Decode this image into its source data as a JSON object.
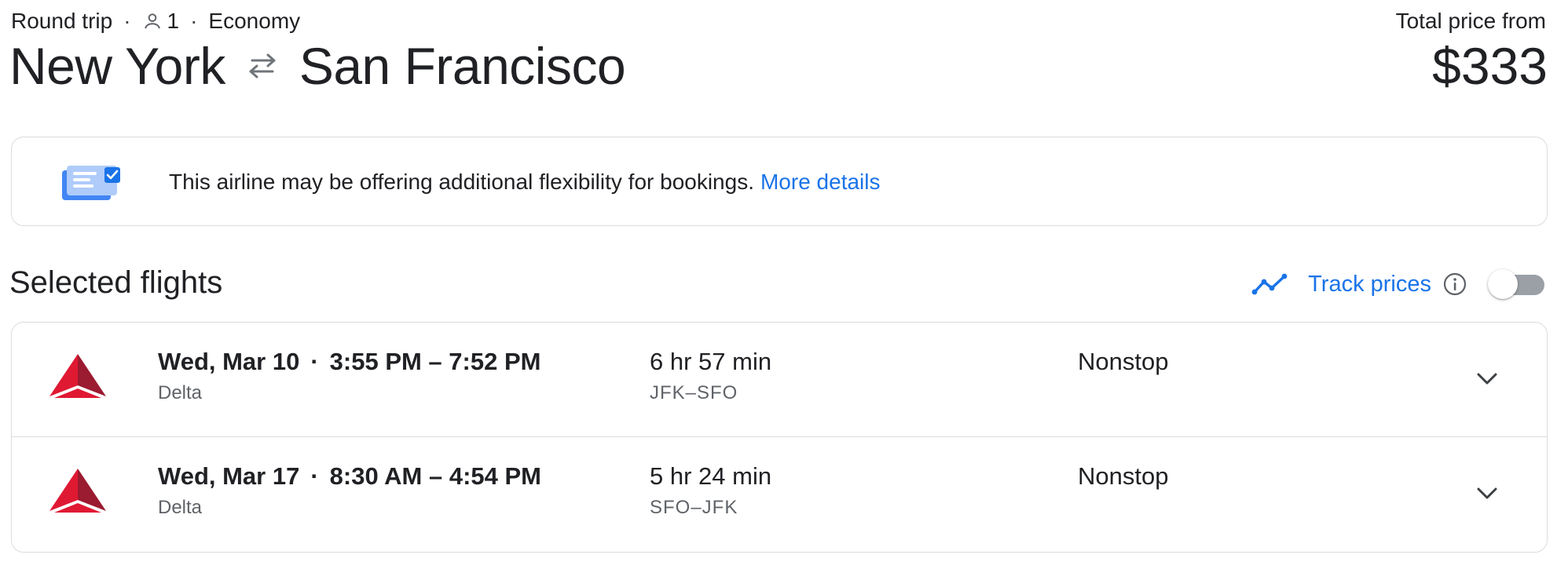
{
  "trip": {
    "type": "Round trip",
    "passengers": "1",
    "cabin": "Economy",
    "separator": "·",
    "origin": "New York",
    "destination": "San Francisco"
  },
  "price": {
    "label": "Total price from",
    "value": "$333"
  },
  "banner": {
    "text": "This airline may be offering additional flexibility for bookings.",
    "link": "More details",
    "icon": "flexible-booking-icon"
  },
  "selected": {
    "title": "Selected flights",
    "track_label": "Track prices",
    "track_enabled": false
  },
  "flights": [
    {
      "date": "Wed, Mar 10",
      "times": "3:55 PM – 7:52 PM",
      "airline": "Delta",
      "duration": "6 hr 57 min",
      "route": "JFK–SFO",
      "stops": "Nonstop"
    },
    {
      "date": "Wed, Mar 17",
      "times": "8:30 AM – 4:54 PM",
      "airline": "Delta",
      "duration": "5 hr 24 min",
      "route": "SFO–JFK",
      "stops": "Nonstop"
    }
  ],
  "colors": {
    "accent": "#1a73e8",
    "text": "#202124",
    "secondary_text": "#5f6368",
    "border": "#dadce0",
    "delta_red": "#e01933",
    "delta_dark": "#9b1b30"
  }
}
